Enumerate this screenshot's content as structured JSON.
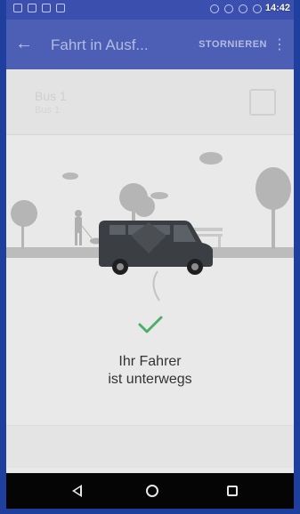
{
  "statusbar": {
    "time": "14:42"
  },
  "appbar": {
    "title": "Fahrt in Ausf...",
    "cancel_label": "STORNIEREN"
  },
  "bus": {
    "name": "Bus 1",
    "subtitle": "Bus 1"
  },
  "message": {
    "line1": "Ihr Fahrer",
    "line2": "ist unterwegs"
  },
  "bottom_button": {
    "label": ""
  },
  "colors": {
    "check": "#4caf64",
    "appbar": "#3f51b5",
    "illustration": "#b5b5b5",
    "van": "#3b3f43"
  },
  "icons": {
    "back": "back-arrow-icon",
    "menu": "more-vert-icon",
    "check": "checkmark-icon",
    "nav": [
      "nav-back-icon",
      "nav-home-icon",
      "nav-recents-icon"
    ]
  }
}
